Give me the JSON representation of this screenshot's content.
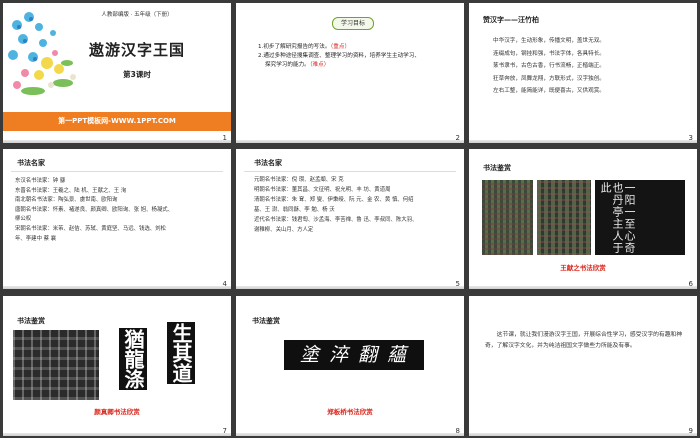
{
  "slides": [
    {
      "num": "1",
      "header": "人教部编版 · 五年级（下册）",
      "title": "遨游汉字王国",
      "subtitle": "第3课时",
      "banner": "第一PPT模板网-WWW.1PPT.COM"
    },
    {
      "num": "2",
      "label": "学习目标",
      "items": [
        "1.初步了解研究报告的写法。",
        "（重点）",
        "2.通过多种途径搜集调查、整理学习的资料，培养学生主动学习、",
        "探究学习的能力。",
        "（难点）"
      ]
    },
    {
      "num": "3",
      "title": "赞汉字——汪竹柏",
      "lines": [
        "中华汉字，生动形象，传播文明，盖世无双。",
        "连缀成句，钢挂和强，书法字体，各具特长。",
        "篆书隶书，古色古香，行书流畅，正楷端正。",
        "狂草奔放，凤舞龙翔，方联形式，汉字独创。",
        "左右工整，能简能详，既便喜古，又供观赏。"
      ]
    },
    {
      "num": "4",
      "title": "书法名家",
      "lines": [
        "东汉名书法家：钟  繇",
        "东晋名书法家：王羲之、陆  机、王献之、王  洵",
        "南北朝名书法家：陶弘景、虞世南、欧阳询",
        "唐朝名书法家：怀素、褚遂良、颜真卿、欧阳询、张  旭、杨凝式、",
        "柳公权",
        "宋朝名书法家：米芾、赵佶、苏轼、黄庭坚、马远、钱选、刘松",
        "年、李建中  蔡  襄"
      ]
    },
    {
      "num": "5",
      "title": "书法名家",
      "lines": [
        "元朝名书法家：倪  瓒、赵孟頫、宋  克",
        "明朝名书法家：董其昌、文征明、祝允明、丰  坊、黄道周",
        "清朝名书法家：朱  耷、郑  燮、伊秉绶、阮  元、金  农、黄  慎、何绍",
        "基、王  澍、翁同龢、李  勉、杨  沃",
        "近代名书法家：钱君匋、沙孟海、李苦禅、鲁  迅、李叔同、陈大羽、",
        "谢稚柳、关山月、方人定"
      ],
      "red_tail": "定"
    },
    {
      "num": "6",
      "title": "书法鉴赏",
      "caption": "王献之书法欣赏"
    },
    {
      "num": "7",
      "title": "书法鉴赏",
      "caption": "颜真卿书法欣赏",
      "big_chars": [
        "生其道",
        "猶龍涤"
      ]
    },
    {
      "num": "8",
      "title": "书法鉴赏",
      "caption": "郑板桥书法欣赏",
      "chars": "塗 淬 翻 蘊"
    },
    {
      "num": "9",
      "text": "这节课，就让我们漫游汉字王国，开展综合性学习，感受汉字的有趣和神奇，了解汉字文化，并为纯洁祖国文字做些力所能及有事。"
    }
  ],
  "colors": {
    "accent_red": "#d9261c",
    "banner_orange": "#ef7d22",
    "banner_text": "#ffffff",
    "goal_green": "#6ea42b"
  }
}
